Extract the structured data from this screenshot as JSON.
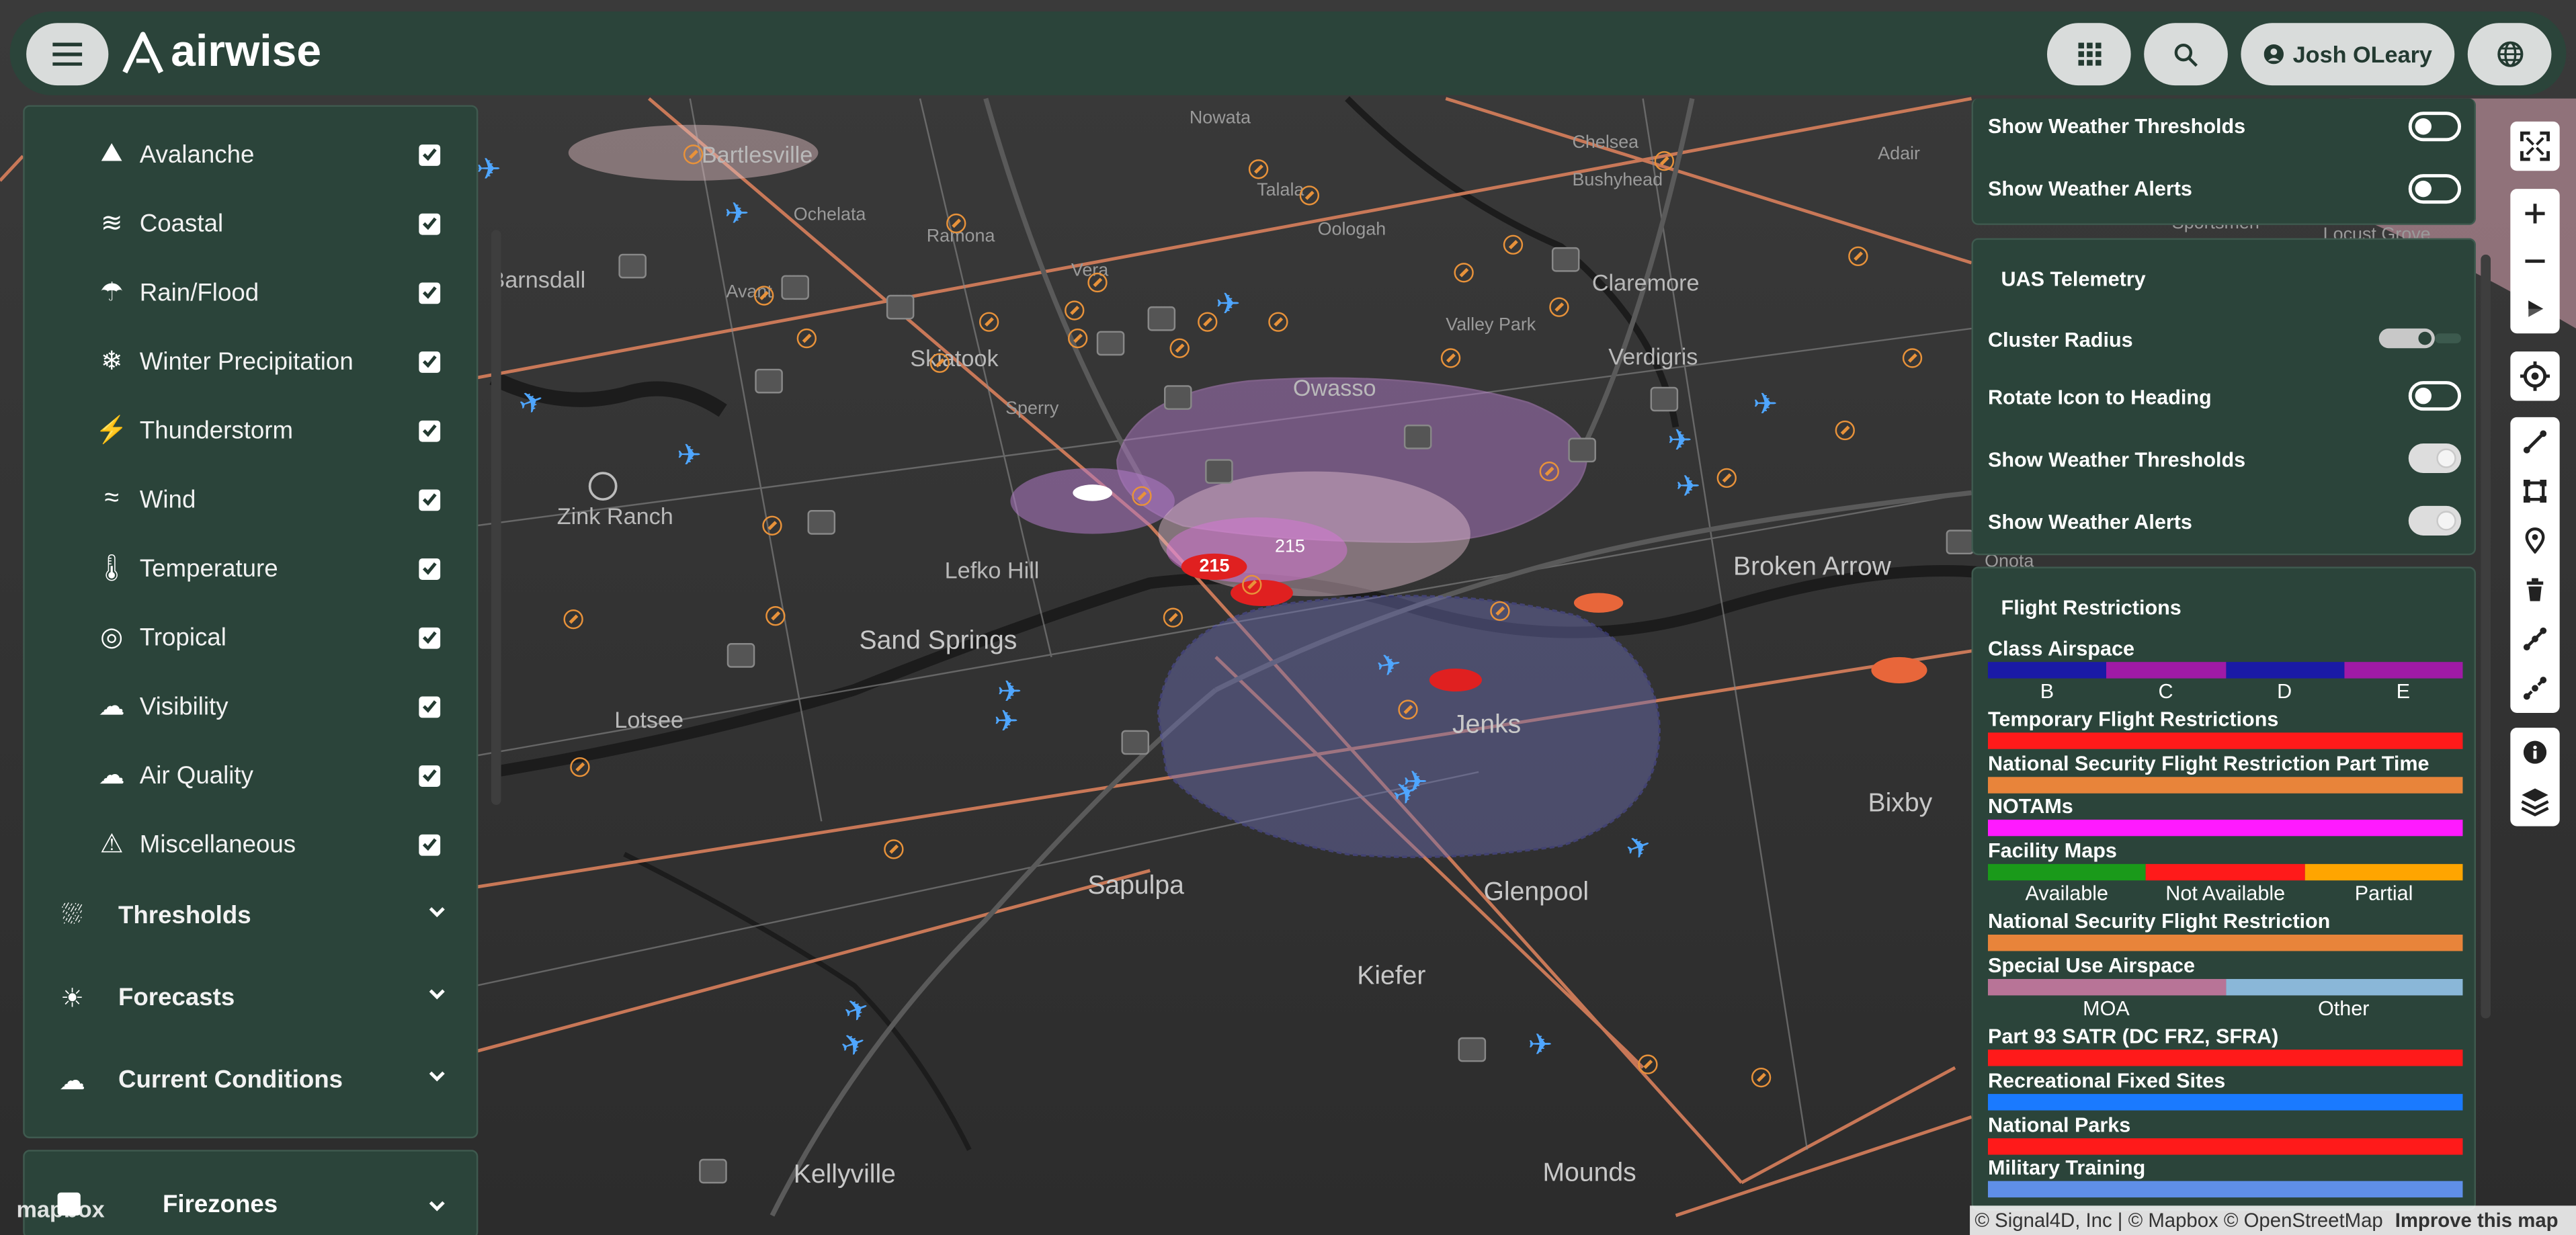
{
  "app": {
    "brand": "airwise",
    "user_name": "Josh OLeary"
  },
  "left_panel": {
    "alert_items": [
      {
        "label": "Avalanche",
        "icon": "avalanche-icon",
        "checked": true
      },
      {
        "label": "Coastal",
        "icon": "coastal-icon",
        "checked": true
      },
      {
        "label": "Rain/Flood",
        "icon": "rain-flood-icon",
        "checked": true
      },
      {
        "label": "Winter Precipitation",
        "icon": "snowflake-icon",
        "checked": true
      },
      {
        "label": "Thunderstorm",
        "icon": "thunderstorm-icon",
        "checked": true
      },
      {
        "label": "Wind",
        "icon": "wind-icon",
        "checked": true
      },
      {
        "label": "Temperature",
        "icon": "thermometer-icon",
        "checked": true
      },
      {
        "label": "Tropical",
        "icon": "hurricane-icon",
        "checked": true
      },
      {
        "label": "Visibility",
        "icon": "fog-icon",
        "checked": true
      },
      {
        "label": "Air Quality",
        "icon": "air-quality-icon",
        "checked": true
      },
      {
        "label": "Miscellaneous",
        "icon": "warning-icon",
        "checked": true
      }
    ],
    "groups": [
      {
        "label": "Thresholds",
        "icon": "thresholds-icon"
      },
      {
        "label": "Forecasts",
        "icon": "forecast-icon"
      },
      {
        "label": "Current Conditions",
        "icon": "cloud-icon"
      }
    ],
    "firezones_label": "Firezones"
  },
  "right_panel": {
    "top_section": {
      "show_weather_thresholds": "Show Weather Thresholds",
      "show_weather_alerts": "Show Weather Alerts"
    },
    "uas_telemetry": {
      "title": "UAS Telemetry",
      "cluster_radius": "Cluster Radius",
      "rotate_icon": "Rotate Icon to Heading",
      "show_weather_thresholds": "Show Weather Thresholds",
      "show_weather_alerts": "Show Weather Alerts"
    },
    "flight_restrictions": {
      "title": "Flight Restrictions",
      "class_airspace": "Class Airspace",
      "class_labels": [
        "B",
        "C",
        "D",
        "E"
      ],
      "class_colors": [
        "#1a1aa6",
        "#a01aa6",
        "#1a1aa6",
        "#a01aa6"
      ],
      "tfr": "Temporary Flight Restrictions",
      "nsfr_part_time": "National Security Flight Restriction Part Time",
      "notams": "NOTAMs",
      "facility_maps": "Facility Maps",
      "facility_labels": [
        "Available",
        "Not Available",
        "Partial"
      ],
      "nsfr": "National Security Flight Restriction",
      "sua": "Special Use Airspace",
      "sua_labels": [
        "MOA",
        "Other"
      ],
      "part93": "Part 93 SATR (DC FRZ, SFRA)",
      "recreational": "Recreational Fixed Sites",
      "national_parks": "National Parks",
      "military_training": "Military Training"
    }
  },
  "map": {
    "attribution": "© Signal4D, Inc | © Mapbox © OpenStreetMap",
    "improve_link": "Improve this map",
    "mapbox_logo": "mapbox",
    "labels": [
      {
        "text": "Bartlesville",
        "cls": ""
      },
      {
        "text": "Nowata",
        "cls": "small"
      },
      {
        "text": "Chelsea",
        "cls": "small"
      },
      {
        "text": "Adair",
        "cls": "small"
      },
      {
        "text": "Bushyhead",
        "cls": "small"
      },
      {
        "text": "Talala",
        "cls": "small"
      },
      {
        "text": "Ochelata",
        "cls": "small"
      },
      {
        "text": "Ramona",
        "cls": "small"
      },
      {
        "text": "Oologah",
        "cls": "small"
      },
      {
        "text": "Barnsdall",
        "cls": ""
      },
      {
        "text": "Avant",
        "cls": "small"
      },
      {
        "text": "Vera",
        "cls": "small"
      },
      {
        "text": "Claremore",
        "cls": ""
      },
      {
        "text": "Skiatook",
        "cls": ""
      },
      {
        "text": "Valley Park",
        "cls": "small"
      },
      {
        "text": "Verdigris",
        "cls": ""
      },
      {
        "text": "Sperry",
        "cls": "small"
      },
      {
        "text": "Owasso",
        "cls": ""
      },
      {
        "text": "Zink Ranch",
        "cls": ""
      },
      {
        "text": "Lefko Hill",
        "cls": ""
      },
      {
        "text": "Broken Arrow",
        "cls": "big"
      },
      {
        "text": "Sand Springs",
        "cls": "big"
      },
      {
        "text": "Lotsee",
        "cls": ""
      },
      {
        "text": "Jenks",
        "cls": "big"
      },
      {
        "text": "Bixby",
        "cls": "big"
      },
      {
        "text": "Sapulpa",
        "cls": "big"
      },
      {
        "text": "Glenpool",
        "cls": "big"
      },
      {
        "text": "Kiefer",
        "cls": "big"
      },
      {
        "text": "Kellyville",
        "cls": "big"
      },
      {
        "text": "Mounds",
        "cls": "big"
      },
      {
        "text": "Onota",
        "cls": "small"
      },
      {
        "text": "Locust Grove",
        "cls": "small"
      },
      {
        "text": "Sportsmen",
        "cls": "small"
      }
    ],
    "markers": [
      {
        "label": "215"
      },
      {
        "label": "215"
      }
    ]
  }
}
